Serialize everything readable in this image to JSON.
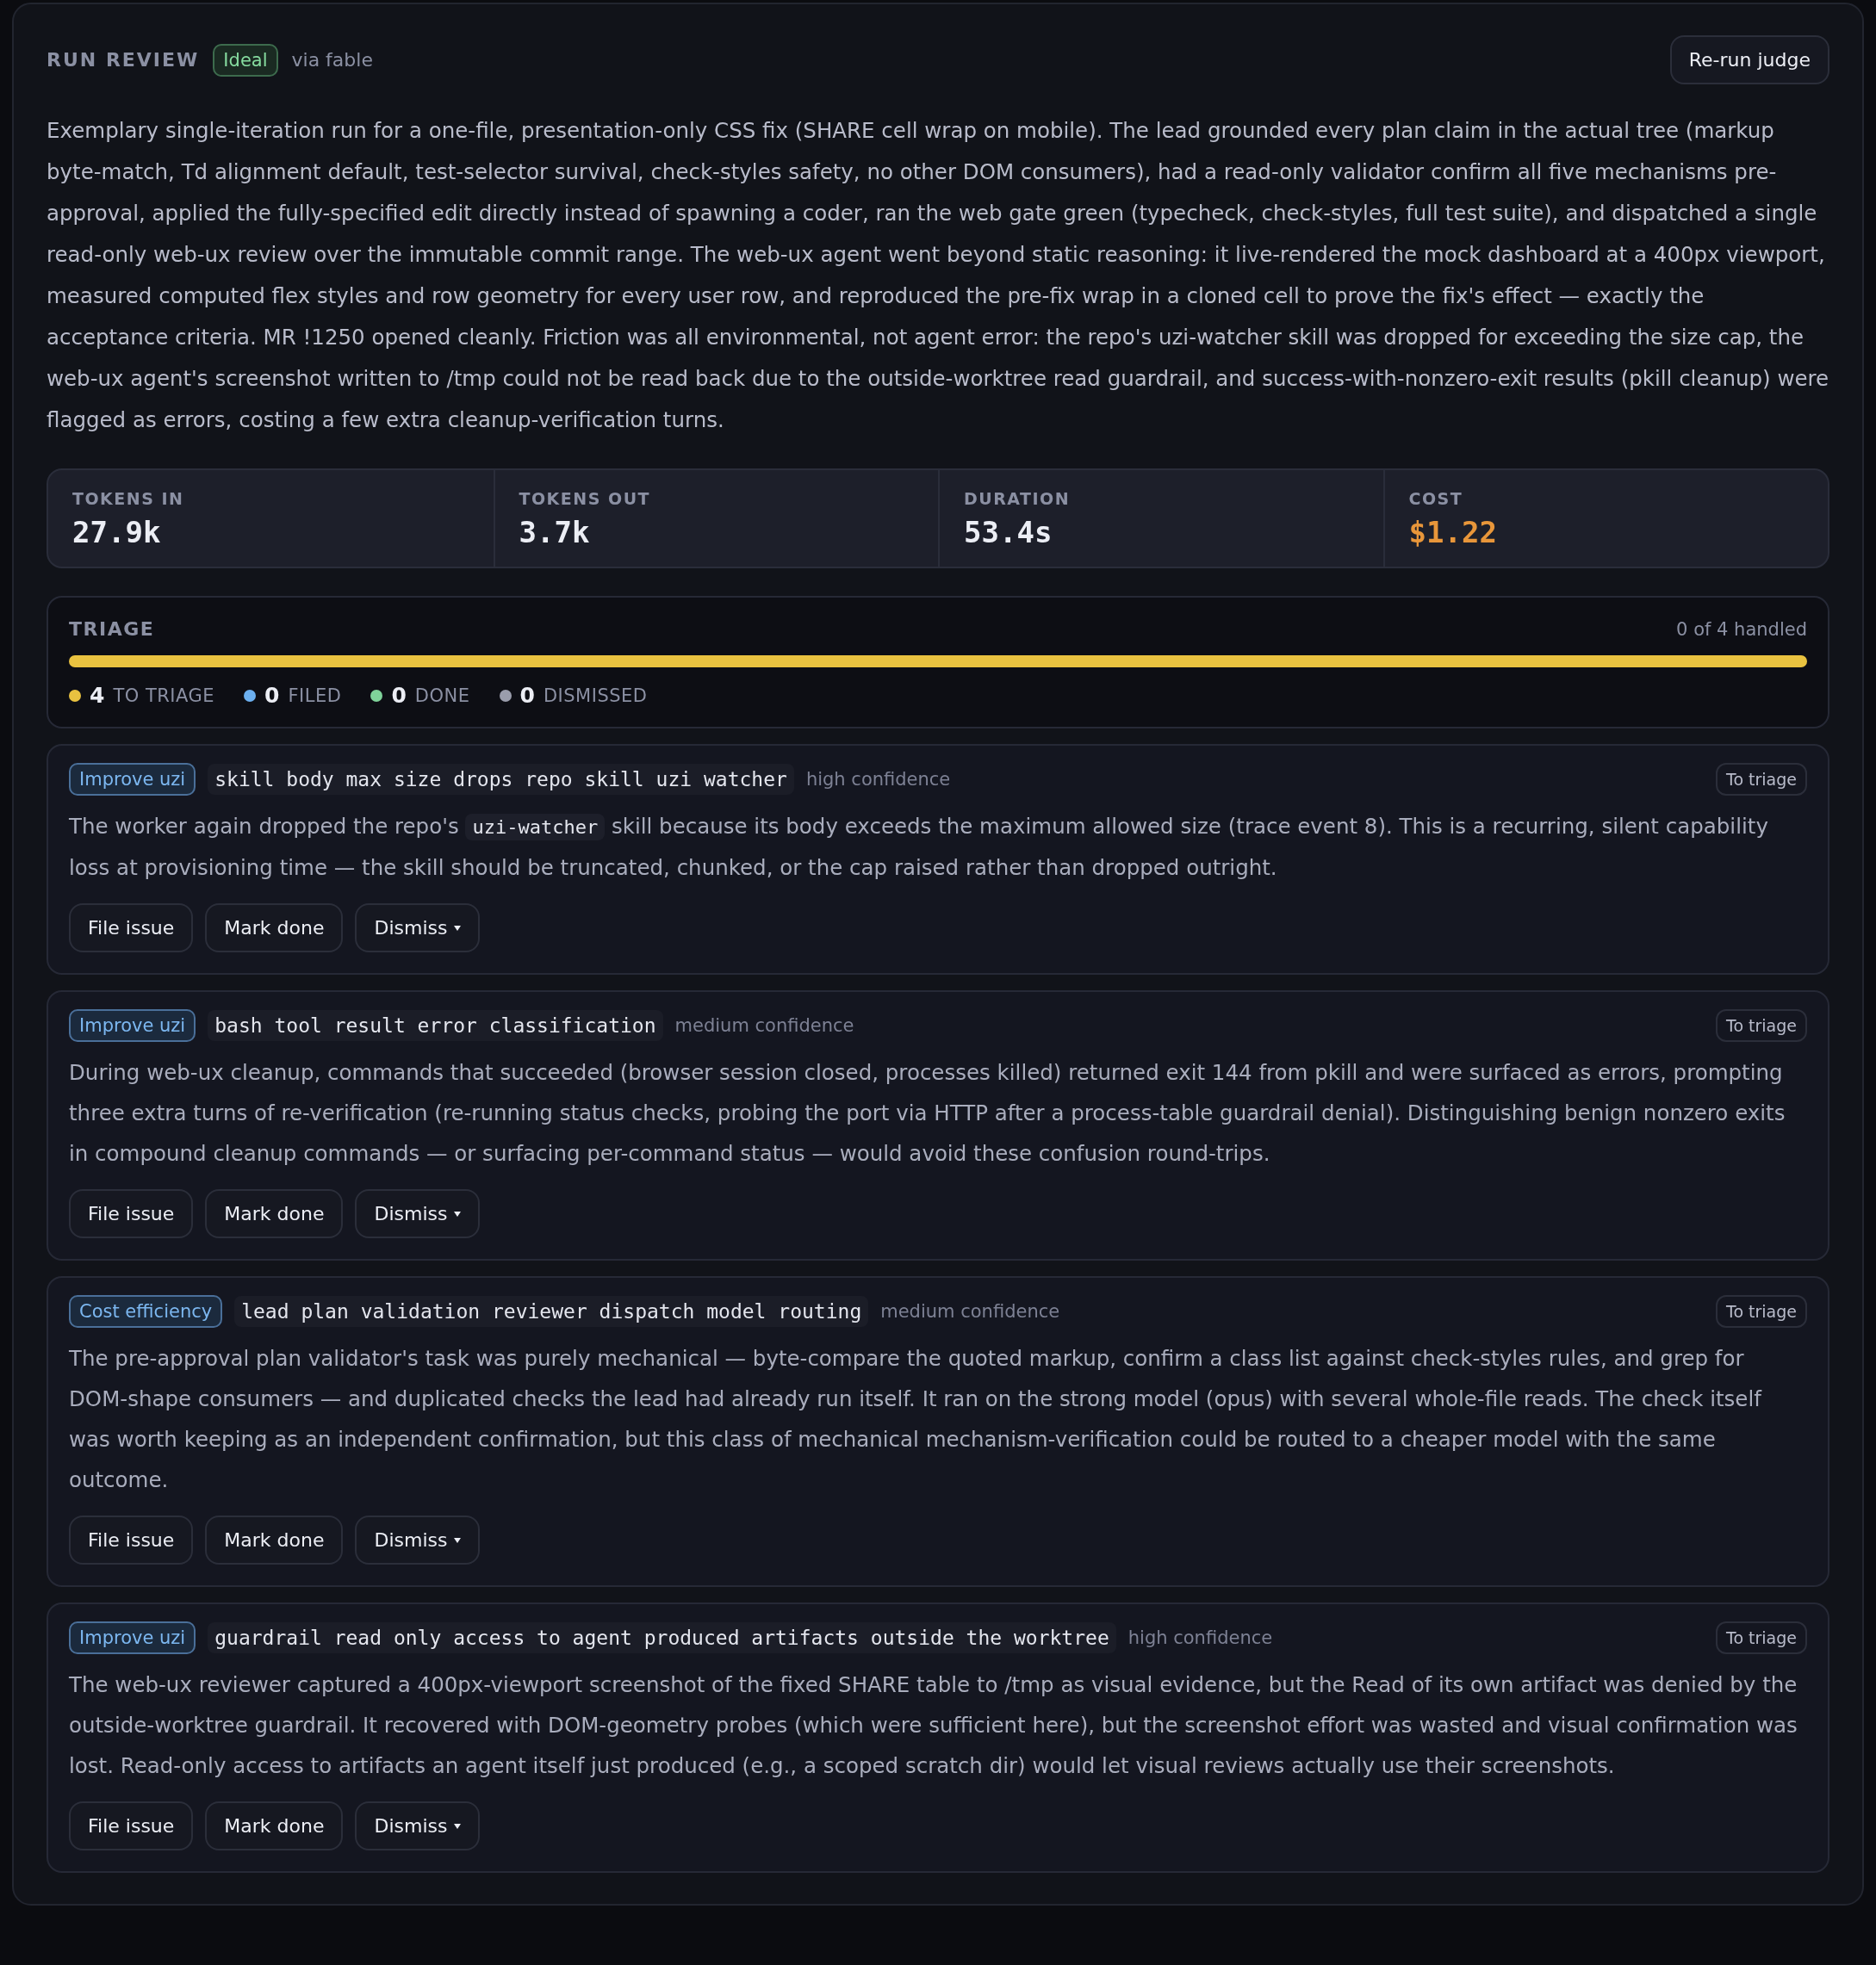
{
  "header": {
    "title": "RUN REVIEW",
    "verdict": "Ideal",
    "source": "via fable",
    "action": "Re-run judge"
  },
  "summary": "Exemplary single-iteration run for a one-file, presentation-only CSS fix (SHARE cell wrap on mobile). The lead grounded every plan claim in the actual tree (markup byte-match, Td alignment default, test-selector survival, check-styles safety, no other DOM consumers), had a read-only validator confirm all five mechanisms pre-approval, applied the fully-specified edit directly instead of spawning a coder, ran the web gate green (typecheck, check-styles, full test suite), and dispatched a single read-only web-ux review over the immutable commit range. The web-ux agent went beyond static reasoning: it live-rendered the mock dashboard at a 400px viewport, measured computed flex styles and row geometry for every user row, and reproduced the pre-fix wrap in a cloned cell to prove the fix's effect — exactly the acceptance criteria. MR !1250 opened cleanly. Friction was all environmental, not agent error: the repo's uzi-watcher skill was dropped for exceeding the size cap, the web-ux agent's screenshot written to /tmp could not be read back due to the outside-worktree read guardrail, and success-with-nonzero-exit results (pkill cleanup) were flagged as errors, costing a few extra cleanup-verification turns.",
  "metrics": [
    {
      "label": "TOKENS IN",
      "value": "27.9k",
      "kind": "count"
    },
    {
      "label": "TOKENS OUT",
      "value": "3.7k",
      "kind": "count"
    },
    {
      "label": "DURATION",
      "value": "53.4s",
      "kind": "count"
    },
    {
      "label": "COST",
      "value": "$1.22",
      "kind": "money"
    }
  ],
  "triage": {
    "title": "TRIAGE",
    "progress": "0 of 4 handled",
    "level": 1,
    "stats": [
      {
        "count": "4",
        "label": "TO TRIAGE",
        "color": "#e9c240"
      },
      {
        "count": "0",
        "label": "FILED",
        "color": "#6cb0f0"
      },
      {
        "count": "0",
        "label": "DONE",
        "color": "#7fd39a"
      },
      {
        "count": "0",
        "label": "DISMISSED",
        "color": "#9a9dac"
      }
    ]
  },
  "findings": [
    {
      "tag": "Improve uzi",
      "slug": "skill body max size drops repo skill uzi watcher",
      "confidence": "high confidence",
      "status": "To triage",
      "body": [
        {
          "kind": "text",
          "text": "The worker again dropped the repo's "
        },
        {
          "kind": "code",
          "text": "uzi-watcher"
        },
        {
          "kind": "text",
          "text": " skill because its body exceeds the maximum allowed size (trace event 8). This is a recurring, silent capability loss at provisioning time — the skill should be truncated, chunked, or the cap raised rather than dropped outright."
        }
      ],
      "actions": [
        "File issue",
        "Mark done",
        "Dismiss"
      ]
    },
    {
      "tag": "Improve uzi",
      "slug": "bash tool result error classification",
      "confidence": "medium confidence",
      "status": "To triage",
      "body": [
        {
          "kind": "text",
          "text": "During web-ux cleanup, commands that succeeded (browser session closed, processes killed) returned exit 144 from pkill and were surfaced as errors, prompting three extra turns of re-verification (re-running status checks, probing the port via HTTP after a process-table guardrail denial). Distinguishing benign nonzero exits in compound cleanup commands — or surfacing per-command status — would avoid these confusion round-trips."
        }
      ],
      "actions": [
        "File issue",
        "Mark done",
        "Dismiss"
      ]
    },
    {
      "tag": "Cost efficiency",
      "slug": "lead plan validation reviewer dispatch model routing",
      "confidence": "medium confidence",
      "status": "To triage",
      "body": [
        {
          "kind": "text",
          "text": "The pre-approval plan validator's task was purely mechanical — byte-compare the quoted markup, confirm a class list against check-styles rules, and grep for DOM-shape consumers — and duplicated checks the lead had already run itself. It ran on the strong model (opus) with several whole-file reads. The check itself was worth keeping as an independent confirmation, but this class of mechanical mechanism-verification could be routed to a cheaper model with the same outcome."
        }
      ],
      "actions": [
        "File issue",
        "Mark done",
        "Dismiss"
      ]
    },
    {
      "tag": "Improve uzi",
      "slug": "guardrail read only access to agent produced artifacts outside the worktree",
      "confidence": "high confidence",
      "status": "To triage",
      "body": [
        {
          "kind": "text",
          "text": "The web-ux reviewer captured a 400px-viewport screenshot of the fixed SHARE table to /tmp as visual evidence, but the Read of its own artifact was denied by the outside-worktree guardrail. It recovered with DOM-geometry probes (which were sufficient here), but the screenshot effort was wasted and visual confirmation was lost. Read-only access to artifacts an agent itself just produced (e.g., a scoped scratch dir) would let visual reviews actually use their screenshots."
        }
      ],
      "actions": [
        "File issue",
        "Mark done",
        "Dismiss"
      ]
    }
  ]
}
